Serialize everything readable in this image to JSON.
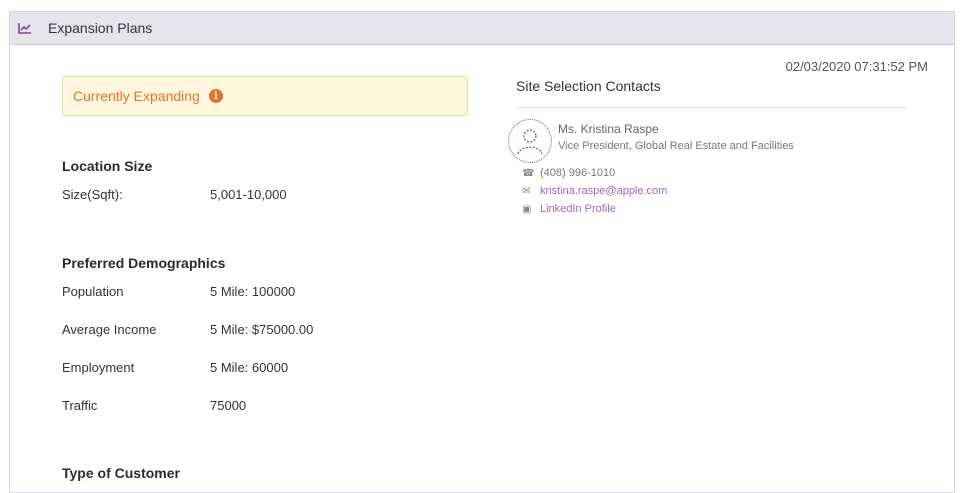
{
  "panel": {
    "title": "Expansion Plans",
    "timestamp": "02/03/2020 07:31:52 PM"
  },
  "status": {
    "label": "Currently Expanding",
    "info_icon": "i"
  },
  "location_size": {
    "heading": "Location Size",
    "rows": [
      {
        "label": "Size(Sqft):",
        "value": "5,001-10,000"
      }
    ]
  },
  "demographics": {
    "heading": "Preferred Demographics",
    "rows": [
      {
        "label": "Population",
        "value": "5 Mile: 100000"
      },
      {
        "label": "Average Income",
        "value": "5 Mile: $75000.00"
      },
      {
        "label": "Employment",
        "value": "5 Mile: 60000"
      },
      {
        "label": "Traffic",
        "value": "75000"
      }
    ]
  },
  "customer_type": {
    "heading": "Type of Customer"
  },
  "contacts": {
    "heading": "Site Selection Contacts",
    "items": [
      {
        "name": "Ms. Kristina Raspe",
        "title": "Vice President, Global Real Estate and Facilities",
        "phone": "(408) 996-1010",
        "email": "kristina.raspe@apple.com",
        "linkedin": "LinkedIn Profile"
      }
    ]
  },
  "colors": {
    "accent": "#7a4a93",
    "status_text": "#e8712d",
    "status_bg": "#fff7dd",
    "header_bg": "#e6e5ee"
  },
  "icons": {
    "header": "chart-line-icon",
    "status": "info-icon",
    "phone": "phone-icon",
    "email": "email-icon",
    "linkedin": "linkedin-icon"
  }
}
